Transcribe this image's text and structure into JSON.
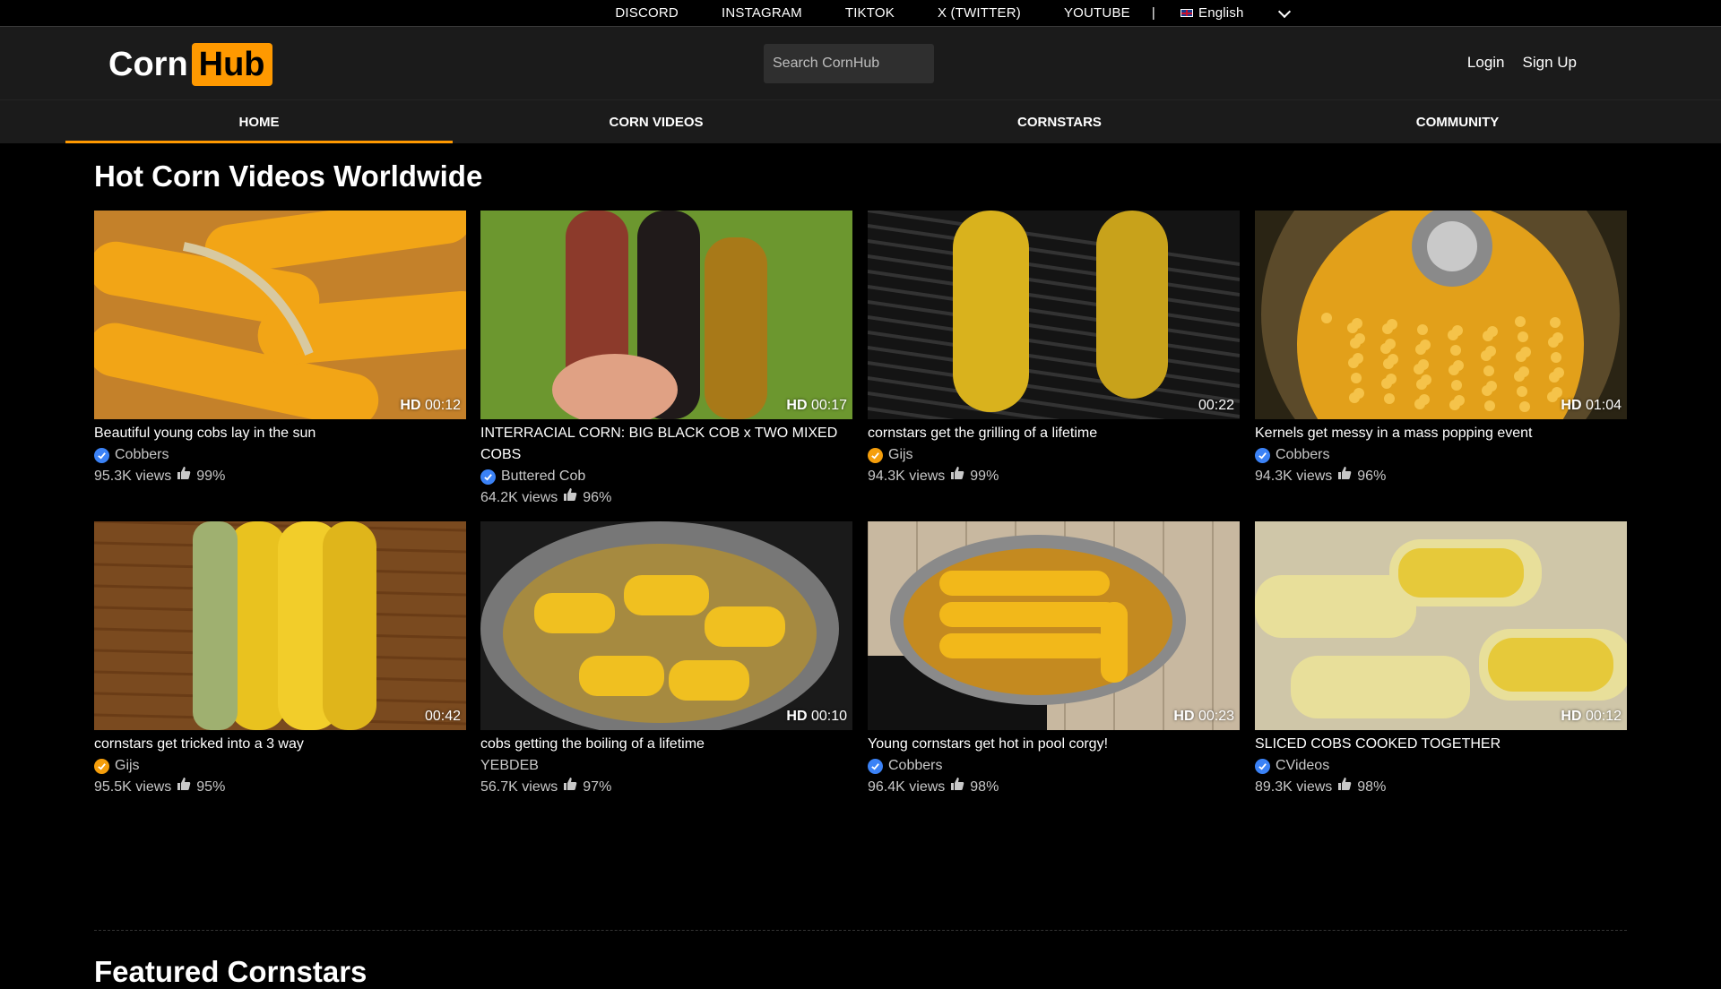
{
  "topbar": {
    "links": [
      "DISCORD",
      "INSTAGRAM",
      "TIKTOK",
      "X (TWITTER)",
      "YOUTUBE"
    ],
    "separator": "|",
    "language": "English"
  },
  "header": {
    "logo_part1": "Corn",
    "logo_part2": "Hub",
    "search_placeholder": "Search CornHub",
    "login": "Login",
    "signup": "Sign Up"
  },
  "nav": {
    "tabs": [
      "HOME",
      "CORN VIDEOS",
      "CORNSTARS",
      "COMMUNITY"
    ],
    "active": "HOME"
  },
  "section": {
    "title": "Hot Corn Videos Worldwide",
    "next_title": "Featured Cornstars"
  },
  "videos": [
    {
      "hd": "HD",
      "duration": "00:12",
      "title": "Beautiful young cobs lay in the sun",
      "channel": "Cobbers",
      "verified": "blue",
      "views": "95.3K views",
      "rating": "99%"
    },
    {
      "hd": "HD",
      "duration": "00:17",
      "title": "INTERRACIAL CORN: BIG BLACK COB x TWO MIXED COBS",
      "channel": "Buttered Cob",
      "verified": "blue",
      "views": "64.2K views",
      "rating": "96%"
    },
    {
      "hd": "",
      "duration": "00:22",
      "title": "cornstars get the grilling of a lifetime",
      "channel": "Gijs",
      "verified": "orange",
      "views": "94.3K views",
      "rating": "99%"
    },
    {
      "hd": "HD",
      "duration": "01:04",
      "title": "Kernels get messy in a mass popping event",
      "channel": "Cobbers",
      "verified": "blue",
      "views": "94.3K views",
      "rating": "96%"
    },
    {
      "hd": "",
      "duration": "00:42",
      "title": "cornstars get tricked into a 3 way",
      "channel": "Gijs",
      "verified": "orange",
      "views": "95.5K views",
      "rating": "95%"
    },
    {
      "hd": "HD",
      "duration": "00:10",
      "title": "cobs getting the boiling of a lifetime",
      "channel": "YEBDEB",
      "verified": "none",
      "views": "56.7K views",
      "rating": "97%"
    },
    {
      "hd": "HD",
      "duration": "00:23",
      "title": "Young cornstars get hot in pool corgy!",
      "channel": "Cobbers",
      "verified": "blue",
      "views": "96.4K views",
      "rating": "98%"
    },
    {
      "hd": "HD",
      "duration": "00:12",
      "title": "SLICED COBS COOKED TOGETHER",
      "channel": "CVideos",
      "verified": "blue",
      "views": "89.3K views",
      "rating": "98%"
    }
  ],
  "colors": {
    "accent": "#ff9900",
    "verified_blue": "#3b82f6",
    "verified_orange": "#f59e0b"
  }
}
